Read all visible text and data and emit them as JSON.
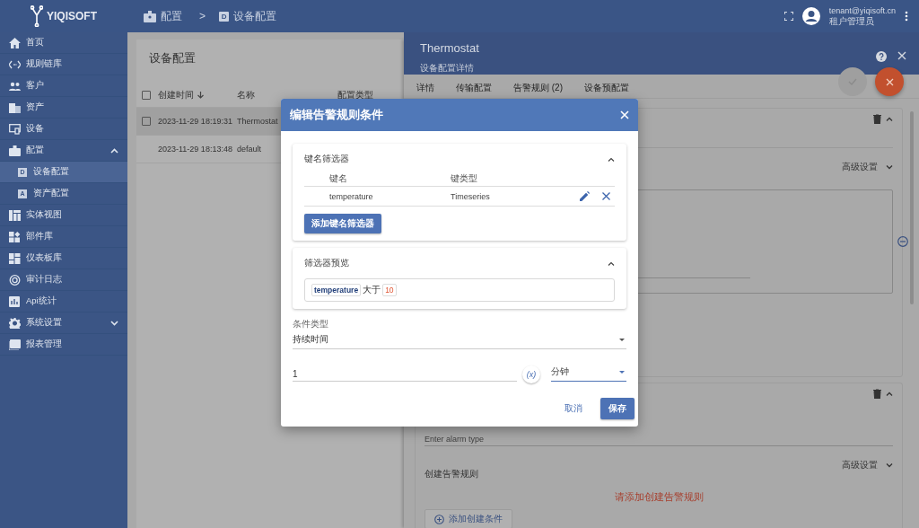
{
  "app": {
    "logo": "YIQISOFT"
  },
  "breadcrumb": {
    "items": [
      {
        "label": "配置"
      },
      {
        "label": "设备配置",
        "badge": "D"
      }
    ],
    "separator": ">"
  },
  "user": {
    "email": "tenant@yiqisoft.cn",
    "role": "租户管理员"
  },
  "sidebar": {
    "items": [
      {
        "label": "首页"
      },
      {
        "label": "规则链库"
      },
      {
        "label": "客户"
      },
      {
        "label": "资产"
      },
      {
        "label": "设备"
      },
      {
        "label": "配置",
        "expanded": true,
        "children": [
          {
            "label": "设备配置",
            "badge": "D",
            "selected": true
          },
          {
            "label": "资产配置",
            "badge": "A",
            "selected": false
          }
        ]
      },
      {
        "label": "实体视图"
      },
      {
        "label": "部件库"
      },
      {
        "label": "仪表板库"
      },
      {
        "label": "审计日志"
      },
      {
        "label": "Api统计"
      },
      {
        "label": "系统设置",
        "expanded": false
      },
      {
        "label": "报表管理"
      }
    ]
  },
  "list": {
    "title": "设备配置",
    "all_checked": false,
    "columns": [
      "创建时间",
      "名称",
      "配置类型"
    ],
    "rows": [
      {
        "created": "2023-11-29 18:19:31",
        "name": "Thermostat",
        "checked": false,
        "highlighted": true
      },
      {
        "created": "2023-11-29 18:13:48",
        "name": "default",
        "highlighted": false
      }
    ]
  },
  "detail": {
    "title": "Thermostat",
    "subtitle": "设备配置详情",
    "tabs": [
      "详情",
      "传输配置",
      "告警规则 (2)",
      "设备预配置"
    ],
    "alarm_cards": [
      {
        "advanced": "高级设置"
      },
      {
        "placeholder": "Enter alarm type",
        "advanced": "高级设置",
        "section": "创建告警规则",
        "warning": "请添加创建告警规则",
        "add_button": "添加创建条件"
      }
    ]
  },
  "dialog": {
    "title": "编辑告警规则条件",
    "key_filters": {
      "title": "键名筛选器",
      "expanded": true,
      "columns": [
        "键名",
        "键类型"
      ],
      "rows": [
        {
          "key": "temperature",
          "type": "Timeseries"
        }
      ],
      "add_button": "添加键名筛选器"
    },
    "preview": {
      "title": "筛选器预览",
      "expanded": true,
      "key": "temperature",
      "operator": "大于",
      "value": "10"
    },
    "condition_type": {
      "label": "条件类型",
      "value": "持续时间"
    },
    "duration": {
      "value": "1",
      "variable_button": "(x)",
      "unit": "分钟"
    },
    "cancel": "取消",
    "save": "保存"
  }
}
